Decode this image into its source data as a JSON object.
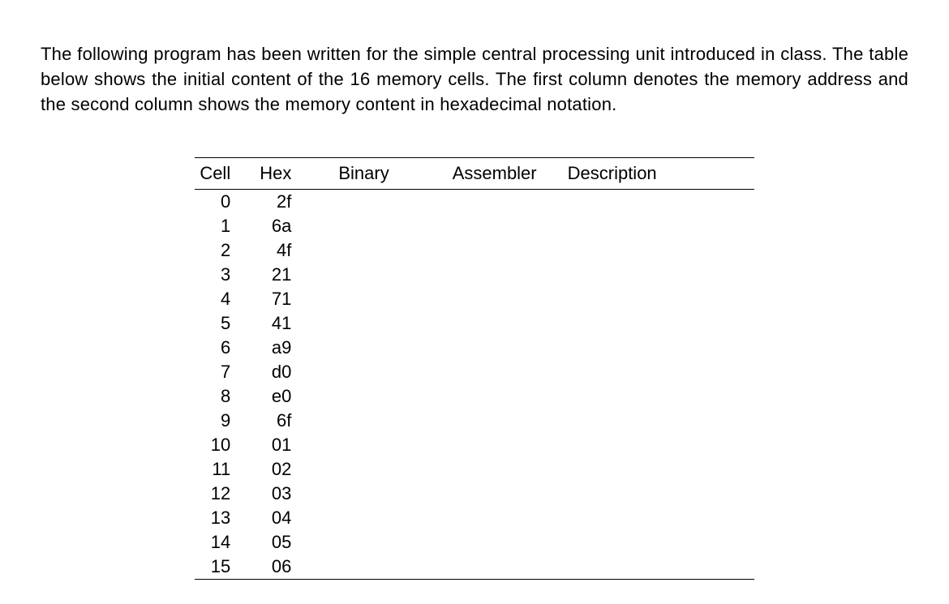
{
  "intro": "The following program has been written for the simple central processing unit introduced in class. The table below shows the initial content of the 16 memory cells. The first column denotes the memory address and the second column shows the memory content in hexadecimal notation.",
  "headers": {
    "cell": "Cell",
    "hex": "Hex",
    "binary": "Binary",
    "assembler": "Assembler",
    "description": "Description"
  },
  "rows": [
    {
      "cell": "0",
      "hex": "2f",
      "binary": "",
      "assembler": "",
      "description": ""
    },
    {
      "cell": "1",
      "hex": "6a",
      "binary": "",
      "assembler": "",
      "description": ""
    },
    {
      "cell": "2",
      "hex": "4f",
      "binary": "",
      "assembler": "",
      "description": ""
    },
    {
      "cell": "3",
      "hex": "21",
      "binary": "",
      "assembler": "",
      "description": ""
    },
    {
      "cell": "4",
      "hex": "71",
      "binary": "",
      "assembler": "",
      "description": ""
    },
    {
      "cell": "5",
      "hex": "41",
      "binary": "",
      "assembler": "",
      "description": ""
    },
    {
      "cell": "6",
      "hex": "a9",
      "binary": "",
      "assembler": "",
      "description": ""
    },
    {
      "cell": "7",
      "hex": "d0",
      "binary": "",
      "assembler": "",
      "description": ""
    },
    {
      "cell": "8",
      "hex": "e0",
      "binary": "",
      "assembler": "",
      "description": ""
    },
    {
      "cell": "9",
      "hex": "6f",
      "binary": "",
      "assembler": "",
      "description": ""
    },
    {
      "cell": "10",
      "hex": "01",
      "binary": "",
      "assembler": "",
      "description": ""
    },
    {
      "cell": "11",
      "hex": "02",
      "binary": "",
      "assembler": "",
      "description": ""
    },
    {
      "cell": "12",
      "hex": "03",
      "binary": "",
      "assembler": "",
      "description": ""
    },
    {
      "cell": "13",
      "hex": "04",
      "binary": "",
      "assembler": "",
      "description": ""
    },
    {
      "cell": "14",
      "hex": "05",
      "binary": "",
      "assembler": "",
      "description": ""
    },
    {
      "cell": "15",
      "hex": "06",
      "binary": "",
      "assembler": "",
      "description": ""
    }
  ]
}
